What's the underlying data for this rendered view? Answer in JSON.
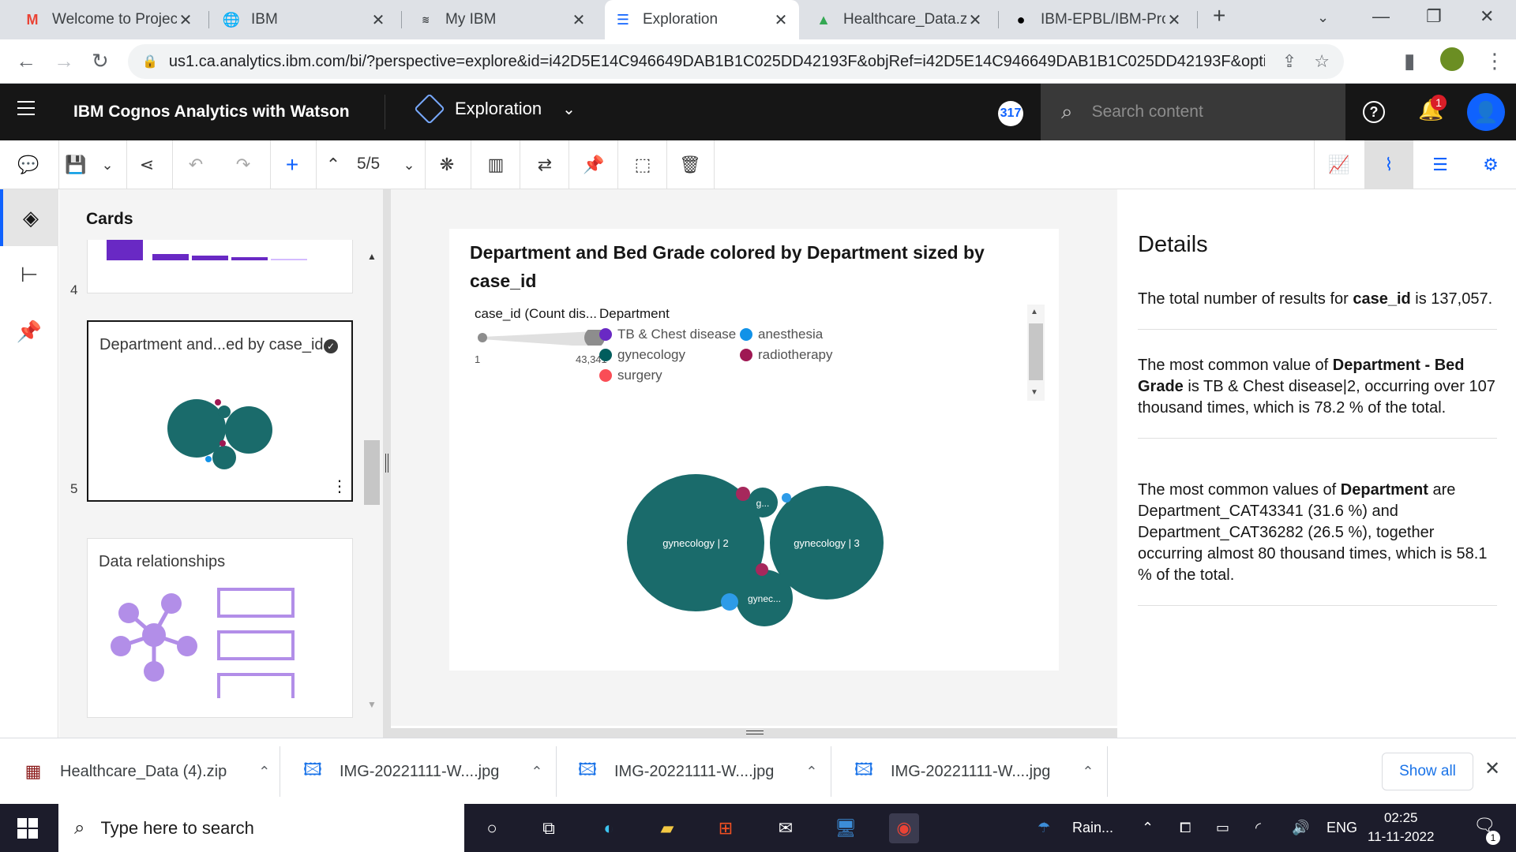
{
  "browser": {
    "tabs": [
      {
        "title": "Welcome to Project",
        "icon": "gmail-icon"
      },
      {
        "title": "IBM",
        "icon": "globe-icon"
      },
      {
        "title": "My IBM",
        "icon": "ibm-icon"
      },
      {
        "title": "Exploration",
        "icon": "cognos-icon"
      },
      {
        "title": "Healthcare_Data.zip",
        "icon": "google-drive-icon"
      },
      {
        "title": "IBM-EPBL/IBM-Proj",
        "icon": "github-icon"
      }
    ],
    "url": "us1.ca.analytics.ibm.com/bi/?perspective=explore&id=i42D5E14C946649DAB1B1C025DD42193F&objRef=i42D5E14C946649DAB1B1C025DD42193F&opti..."
  },
  "header": {
    "product": "IBM Cognos Analytics with Watson",
    "perspective": "Exploration",
    "user_count": "317",
    "search_placeholder": "Search content",
    "notification_count": "1"
  },
  "toolbar": {
    "pager": "5/5"
  },
  "cards": {
    "title": "Cards",
    "items": [
      {
        "number": "4",
        "title": ""
      },
      {
        "number": "5",
        "title": "Department and...ed by case_id"
      },
      {
        "number": "",
        "title": "Data relationships"
      }
    ]
  },
  "viz": {
    "title": "Department and Bed Grade colored by Department sized by case_id",
    "size_legend": {
      "title": "case_id (Count dis...",
      "min": "1",
      "max": "43,341"
    },
    "color_legend": {
      "title": "Department",
      "items": [
        {
          "label": "TB & Chest disease",
          "color": "#6929c4"
        },
        {
          "label": "anesthesia",
          "color": "#1192e8"
        },
        {
          "label": "gynecology",
          "color": "#005d5d"
        },
        {
          "label": "radiotherapy",
          "color": "#9f1853"
        },
        {
          "label": "surgery",
          "color": "#fa4d56"
        }
      ]
    }
  },
  "chart_data": {
    "type": "packed-bubble",
    "title": "Department and Bed Grade colored by Department sized by case_id",
    "size_measure": "case_id (Count dis...",
    "size_range": [
      1,
      43341
    ],
    "color_by": "Department",
    "bubbles": [
      {
        "label": "gynecology | 2",
        "department": "gynecology",
        "color": "#005d5d"
      },
      {
        "label": "gynecology | 3",
        "department": "gynecology",
        "color": "#005d5d"
      },
      {
        "label": "gynec...",
        "department": "gynecology",
        "color": "#005d5d"
      },
      {
        "label": "g...",
        "department": "gynecology",
        "color": "#005d5d"
      },
      {
        "label": "",
        "department": "radiotherapy",
        "color": "#9f1853"
      },
      {
        "label": "",
        "department": "anesthesia",
        "color": "#1192e8"
      },
      {
        "label": "",
        "department": "anesthesia",
        "color": "#1192e8"
      },
      {
        "label": "",
        "department": "radiotherapy",
        "color": "#9f1853"
      }
    ]
  },
  "details": {
    "title": "Details",
    "insights": [
      {
        "parts": [
          {
            "t": "The total number of results for "
          },
          {
            "t": "case_id",
            "b": true
          },
          {
            "t": " is 137,057."
          }
        ]
      },
      {
        "parts": [
          {
            "t": "The most common value of "
          },
          {
            "t": "Department - Bed Grade",
            "b": true
          },
          {
            "t": " is TB & Chest disease|2, occurring over 107 thousand times, which is 78.2 % of the total."
          }
        ]
      },
      {
        "parts": [
          {
            "t": "The most common values of "
          },
          {
            "t": "Department",
            "b": true
          },
          {
            "t": " are Department_CAT43341 (31.6 %) and Department_CAT36282 (26.5 %), together occurring almost 80 thousand times, which is 58.1 % of the total."
          }
        ]
      }
    ]
  },
  "downloads": {
    "items": [
      {
        "name": "Healthcare_Data (4).zip",
        "icon": "winrar-icon"
      },
      {
        "name": "IMG-20221111-W....jpg",
        "icon": "image-file-icon"
      },
      {
        "name": "IMG-20221111-W....jpg",
        "icon": "image-file-icon"
      },
      {
        "name": "IMG-20221111-W....jpg",
        "icon": "image-file-icon"
      }
    ],
    "show_all": "Show all"
  },
  "taskbar": {
    "search_placeholder": "Type here to search",
    "weather": "Rain...",
    "language": "ENG",
    "time": "02:25",
    "date": "11-11-2022",
    "notifications": "1"
  }
}
